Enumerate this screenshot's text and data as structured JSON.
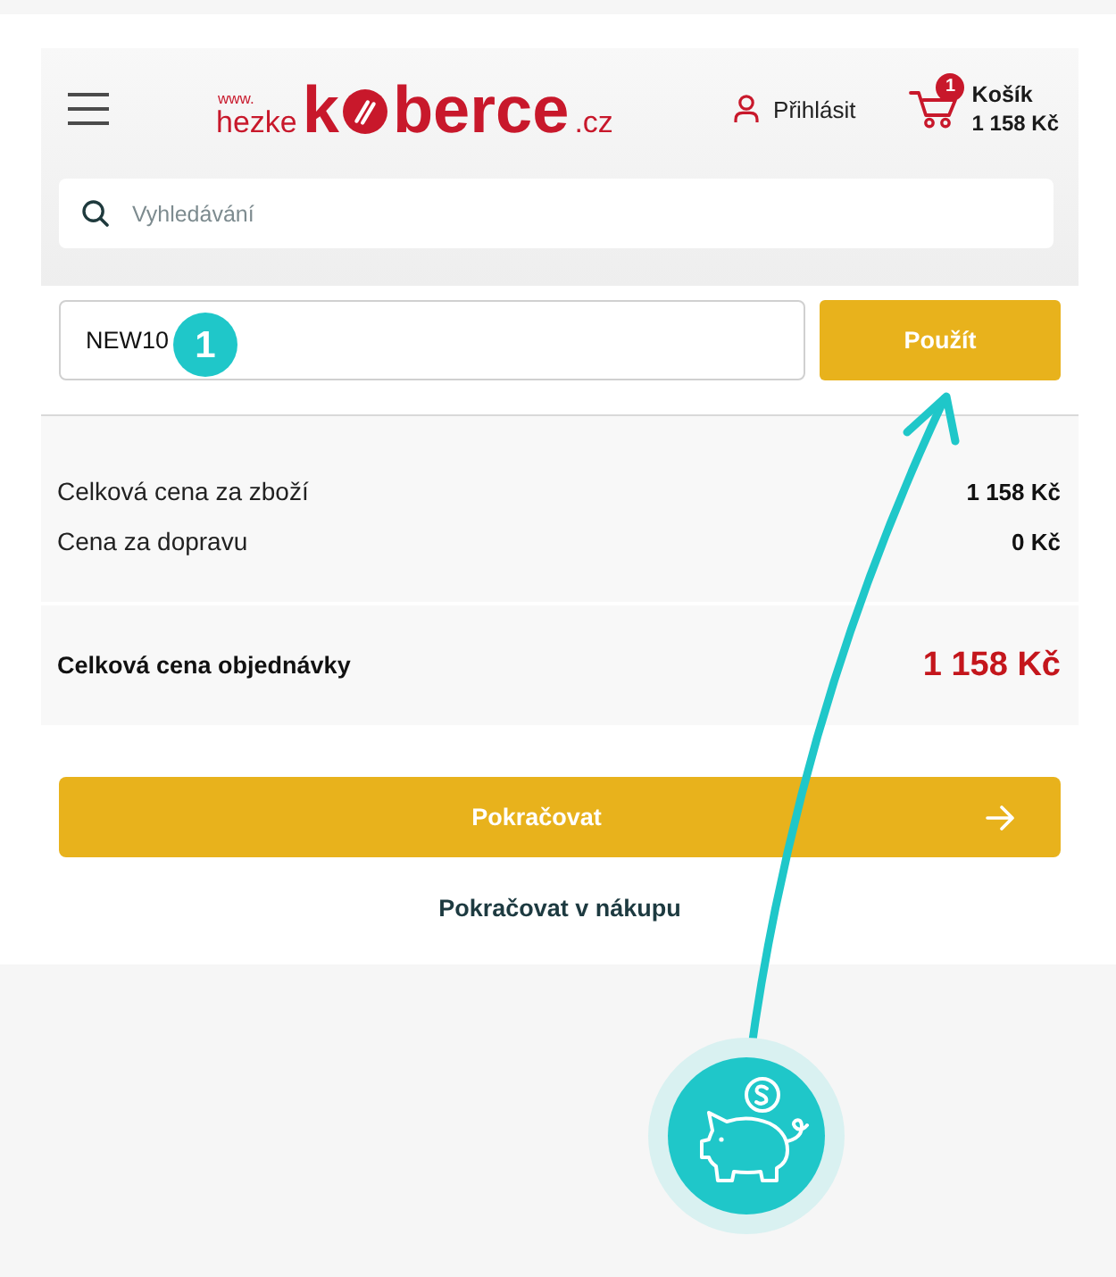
{
  "header": {
    "logo": {
      "prefix": "www.",
      "name": "hezke",
      "brand_start": "k",
      "brand_end": "berce",
      "domain": ".cz"
    },
    "login": {
      "label": "Přihlásit"
    },
    "cart": {
      "count": "1",
      "label": "Košík",
      "total": "1 158 Kč"
    }
  },
  "search": {
    "placeholder": "Vyhledávání"
  },
  "coupon": {
    "value": "NEW10",
    "button": "Použít"
  },
  "summary": {
    "rows": [
      {
        "label": "Celková cena za zboží",
        "value": "1 158 Kč"
      },
      {
        "label": "Cena za dopravu",
        "value": "0 Kč"
      }
    ],
    "total": {
      "label": "Celková cena objednávky",
      "value": "1 158 Kč"
    }
  },
  "actions": {
    "continue": "Pokračovat",
    "continue_shopping": "Pokračovat v nákupu"
  },
  "annotation": {
    "step": "1"
  }
}
